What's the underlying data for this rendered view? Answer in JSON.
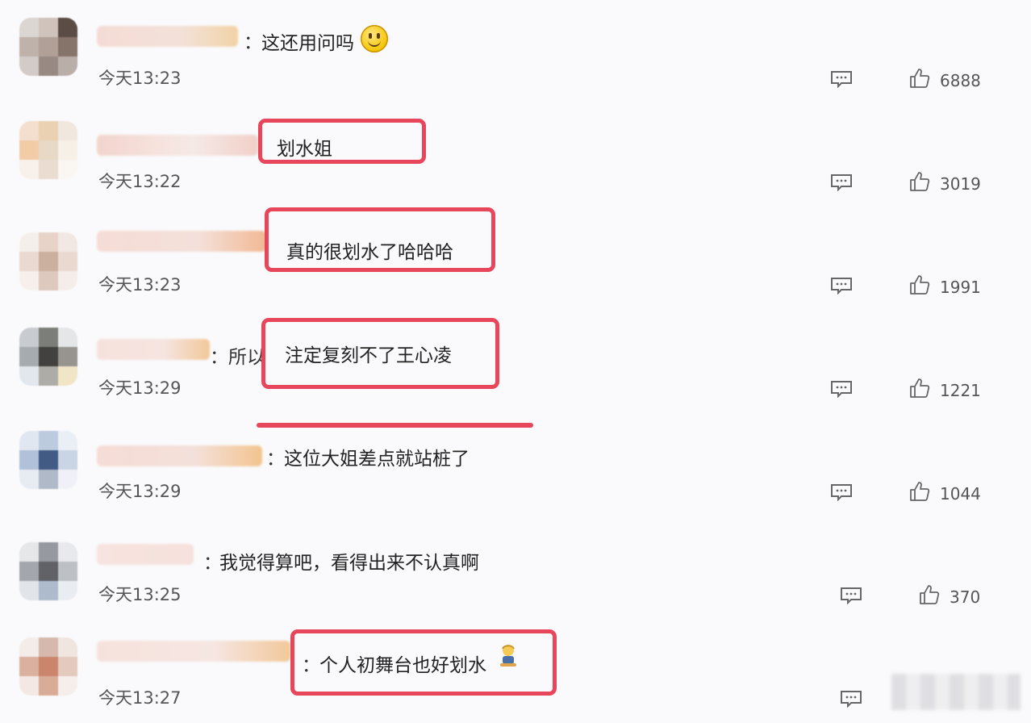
{
  "comments": [
    {
      "prefix": "：",
      "text": "这还用问吗",
      "emoji": "smiley-icon",
      "time": "今天13:23",
      "likes": "6888",
      "highlight": false
    },
    {
      "prefix": "",
      "text": "划水姐",
      "time": "今天13:22",
      "likes": "3019",
      "highlight": true
    },
    {
      "prefix": "",
      "text": "真的很划水了哈哈哈",
      "time": "今天13:23",
      "likes": "1991",
      "highlight": true
    },
    {
      "prefix": "：所以",
      "text": "注定复刻不了王心凌",
      "time": "今天13:29",
      "likes": "1221",
      "highlight": true
    },
    {
      "prefix": "：",
      "text": "这位大姐差点就站桩了",
      "time": "今天13:29",
      "likes": "1044",
      "highlight": false
    },
    {
      "prefix": "：",
      "text": "我觉得算吧，看得出来不认真啊",
      "time": "今天13:25",
      "likes": "370",
      "highlight": false
    },
    {
      "prefix": "：",
      "text": "个人初舞台也好划水",
      "emoji": "person-emoji-icon",
      "time": "今天13:27",
      "likes": "",
      "highlight": true
    }
  ],
  "colors": {
    "highlight": "#e8465a",
    "text": "#222222",
    "meta": "#555555"
  }
}
